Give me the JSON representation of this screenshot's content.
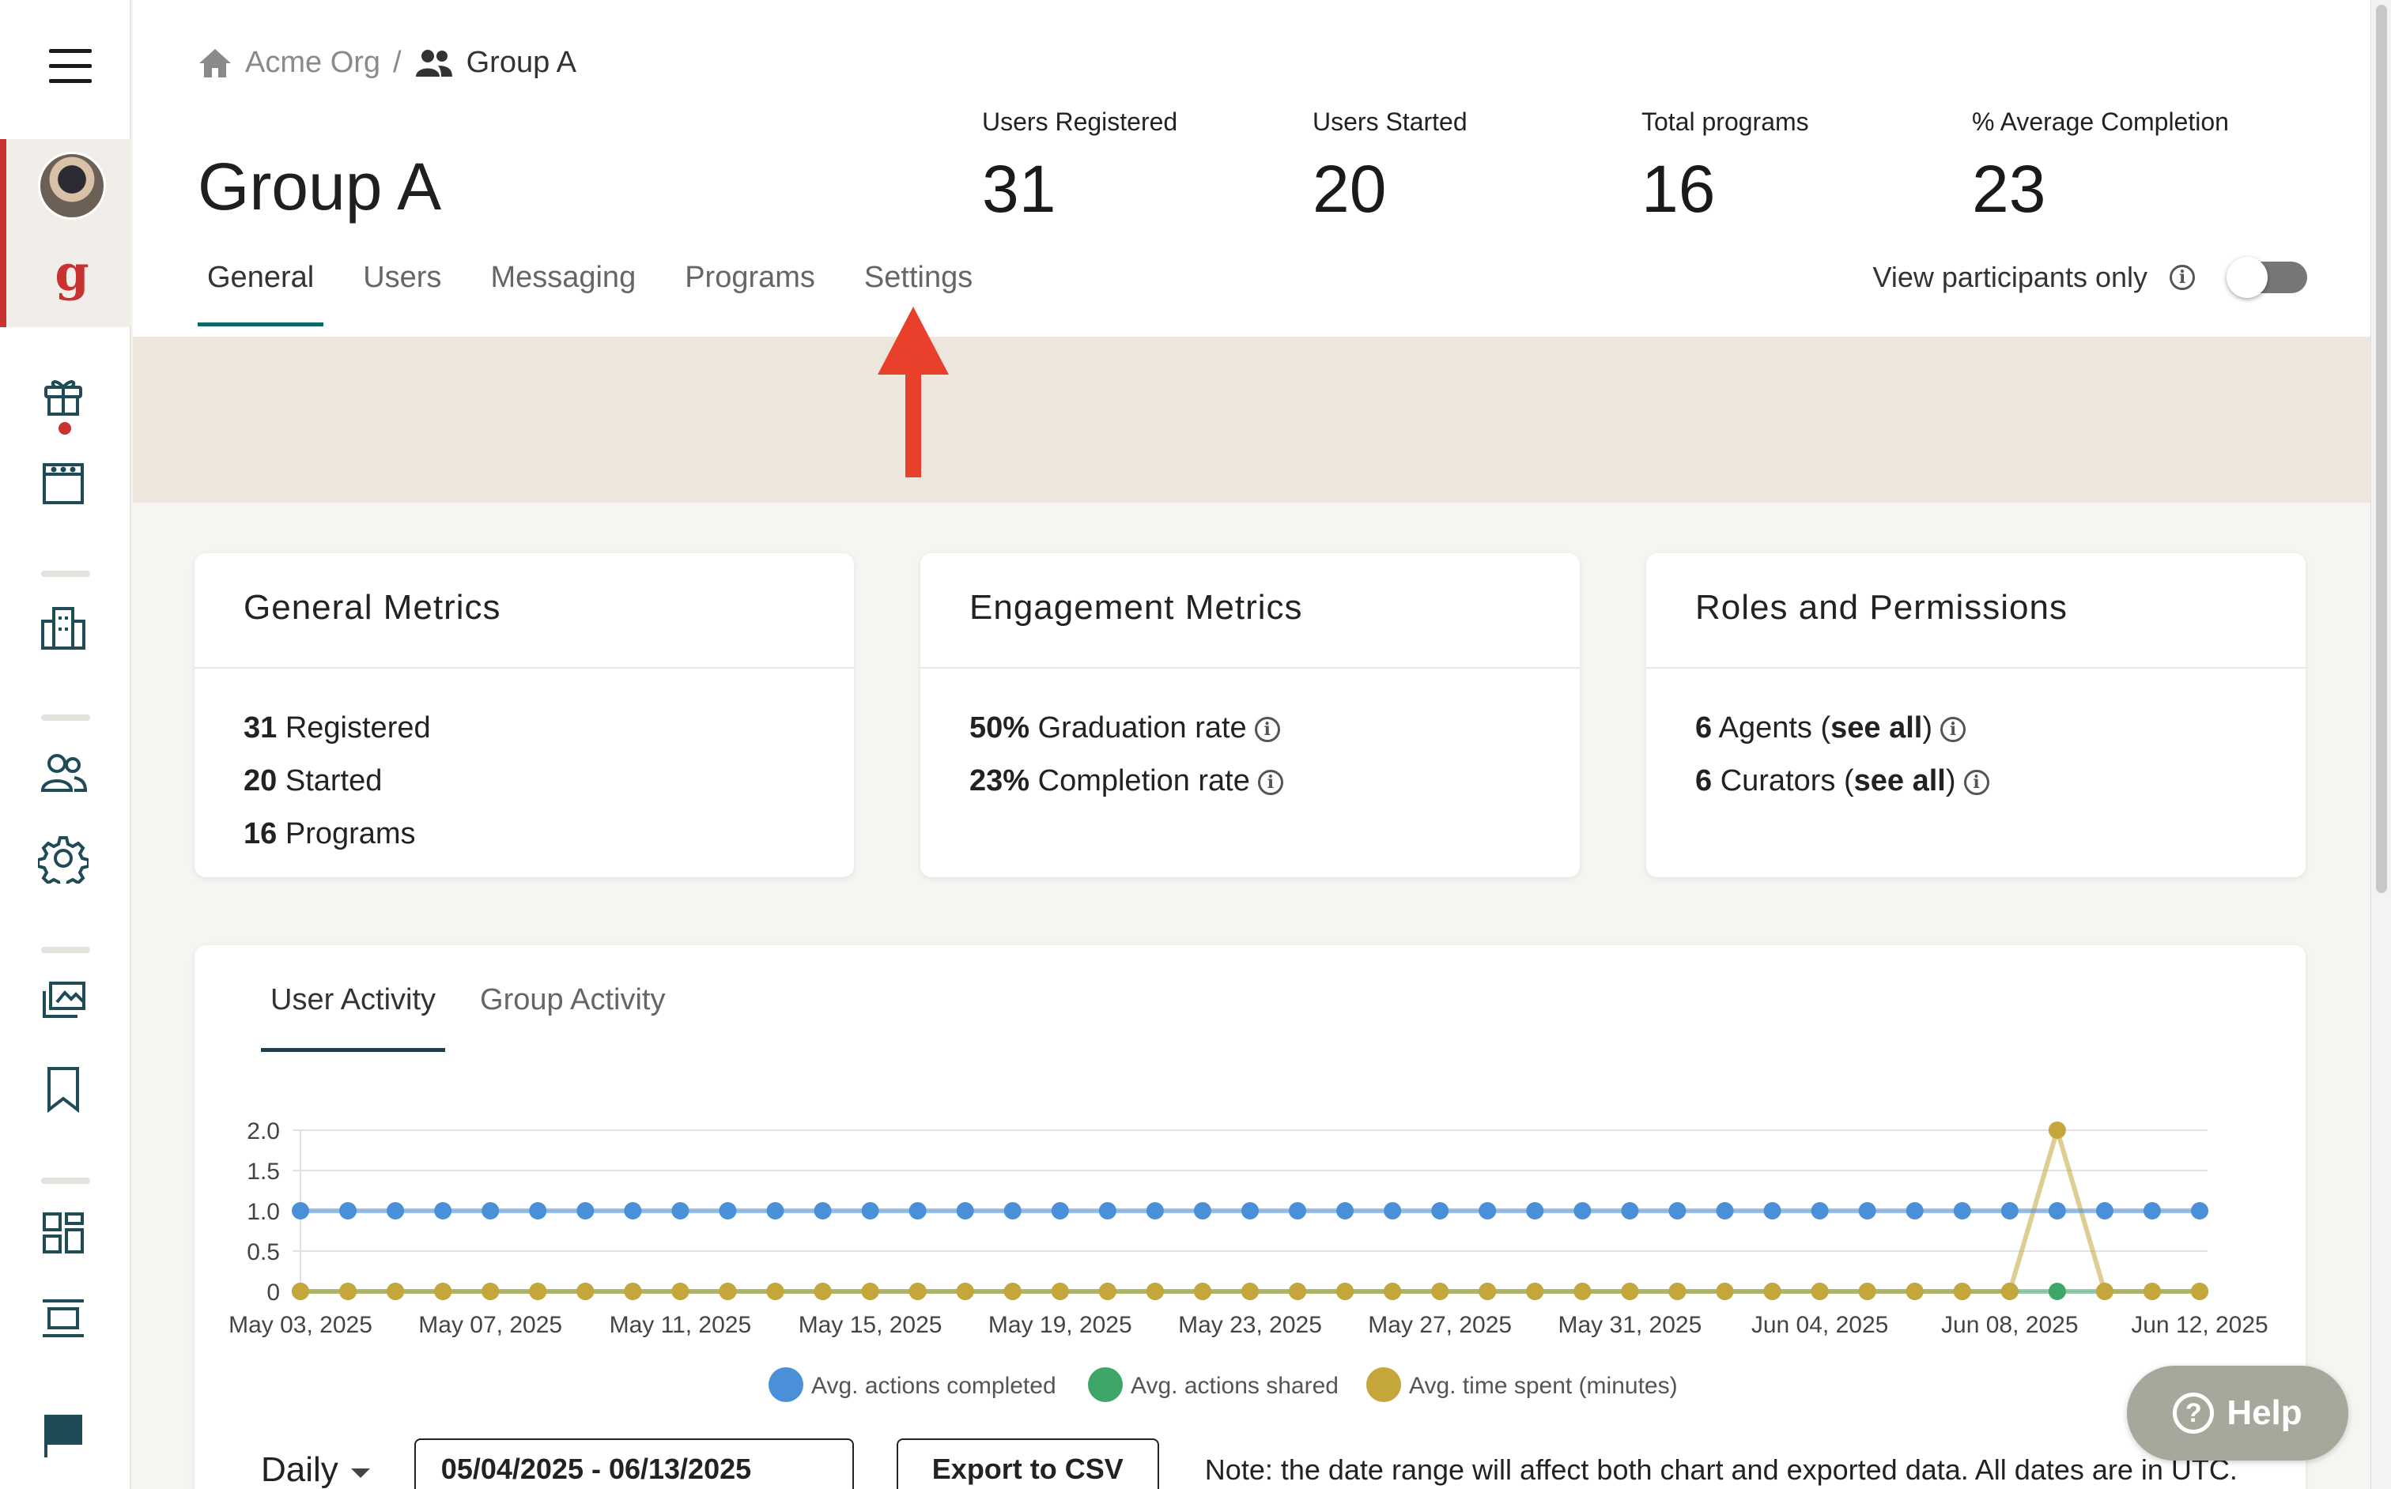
{
  "breadcrumb": {
    "org": "Acme Org",
    "separator": "/",
    "group": "Group A"
  },
  "page_title": "Group A",
  "stats": [
    {
      "label": "Users Registered",
      "value": "31"
    },
    {
      "label": "Users Started",
      "value": "20"
    },
    {
      "label": "Total programs",
      "value": "16"
    },
    {
      "label": "% Average Completion",
      "value": "23"
    }
  ],
  "tabs": [
    {
      "label": "General",
      "active": true
    },
    {
      "label": "Users"
    },
    {
      "label": "Messaging"
    },
    {
      "label": "Programs"
    },
    {
      "label": "Settings"
    }
  ],
  "participants_toggle": {
    "label": "View participants only",
    "on": false
  },
  "cards": {
    "general": {
      "title": "General Metrics",
      "rows": [
        {
          "num": "31",
          "text": "Registered"
        },
        {
          "num": "20",
          "text": "Started"
        },
        {
          "num": "16",
          "text": "Programs"
        }
      ]
    },
    "engagement": {
      "title": "Engagement Metrics",
      "rows": [
        {
          "num": "50%",
          "text": "Graduation rate"
        },
        {
          "num": "23%",
          "text": "Completion rate"
        }
      ]
    },
    "roles": {
      "title": "Roles and Permissions",
      "rows": [
        {
          "num": "6",
          "text": "Agents",
          "link": "see all"
        },
        {
          "num": "6",
          "text": "Curators",
          "link": "see all"
        }
      ]
    }
  },
  "activity_tabs": [
    {
      "label": "User Activity",
      "active": true
    },
    {
      "label": "Group Activity"
    }
  ],
  "chart_data": {
    "type": "line",
    "x_start": "2025-05-03",
    "x_count": 41,
    "x_tick_labels": [
      "May 03, 2025",
      "May 07, 2025",
      "May 11, 2025",
      "May 15, 2025",
      "May 19, 2025",
      "May 23, 2025",
      "May 27, 2025",
      "May 31, 2025",
      "Jun 04, 2025",
      "Jun 08, 2025",
      "Jun 12, 2025"
    ],
    "y_ticks": [
      "2.0",
      "1.5",
      "1.0",
      "0.5",
      "0"
    ],
    "ylim": [
      0,
      2
    ],
    "series": [
      {
        "name": "Avg. actions completed",
        "color": "#4a90d9",
        "values": [
          1,
          1,
          1,
          1,
          1,
          1,
          1,
          1,
          1,
          1,
          1,
          1,
          1,
          1,
          1,
          1,
          1,
          1,
          1,
          1,
          1,
          1,
          1,
          1,
          1,
          1,
          1,
          1,
          1,
          1,
          1,
          1,
          1,
          1,
          1,
          1,
          1,
          1,
          1,
          1,
          1
        ]
      },
      {
        "name": "Avg. actions shared",
        "color": "#3fa66a",
        "values": [
          0,
          0,
          0,
          0,
          0,
          0,
          0,
          0,
          0,
          0,
          0,
          0,
          0,
          0,
          0,
          0,
          0,
          0,
          0,
          0,
          0,
          0,
          0,
          0,
          0,
          0,
          0,
          0,
          0,
          0,
          0,
          0,
          0,
          0,
          0,
          0,
          0,
          0,
          0,
          0,
          0
        ]
      },
      {
        "name": "Avg. time spent (minutes)",
        "color": "#c4a63a",
        "values": [
          0,
          0,
          0,
          0,
          0,
          0,
          0,
          0,
          0,
          0,
          0,
          0,
          0,
          0,
          0,
          0,
          0,
          0,
          0,
          0,
          0,
          0,
          0,
          0,
          0,
          0,
          0,
          0,
          0,
          0,
          0,
          0,
          0,
          0,
          0,
          0,
          0,
          2,
          0,
          0,
          0
        ]
      }
    ],
    "legend_position": "bottom"
  },
  "controls": {
    "interval": "Daily",
    "date_range": "05/04/2025 - 06/13/2025",
    "export_label": "Export to CSV",
    "note": "Note: the date range will affect both chart and exported data. All dates are in UTC."
  },
  "help_label": "Help",
  "icons": [
    "menu-icon",
    "home-icon",
    "group-icon",
    "gift-icon",
    "calendar-icon",
    "buildings-icon",
    "users-icon",
    "gear-icon",
    "library-icon",
    "bookmark-icon",
    "dashboard-icon",
    "layout-icon",
    "flag-icon",
    "info-icon",
    "help-icon"
  ]
}
